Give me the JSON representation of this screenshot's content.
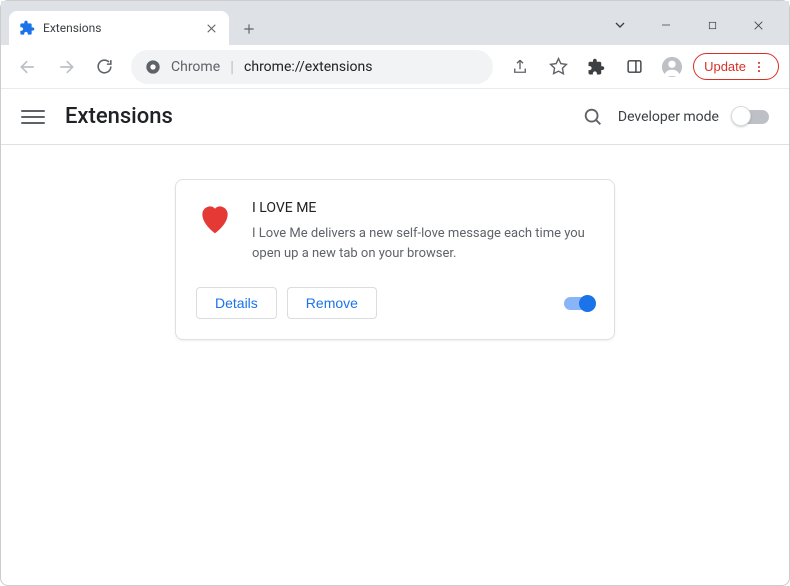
{
  "window": {
    "tab_title": "Extensions"
  },
  "toolbar": {
    "address_label": "Chrome",
    "address_url": "chrome://extensions",
    "update_label": "Update"
  },
  "page": {
    "title": "Extensions",
    "dev_mode_label": "Developer mode"
  },
  "extension": {
    "name": "I LOVE ME",
    "description": "I Love Me delivers a new self-love message each time you open up a new tab on your browser.",
    "details_label": "Details",
    "remove_label": "Remove",
    "enabled": true
  }
}
